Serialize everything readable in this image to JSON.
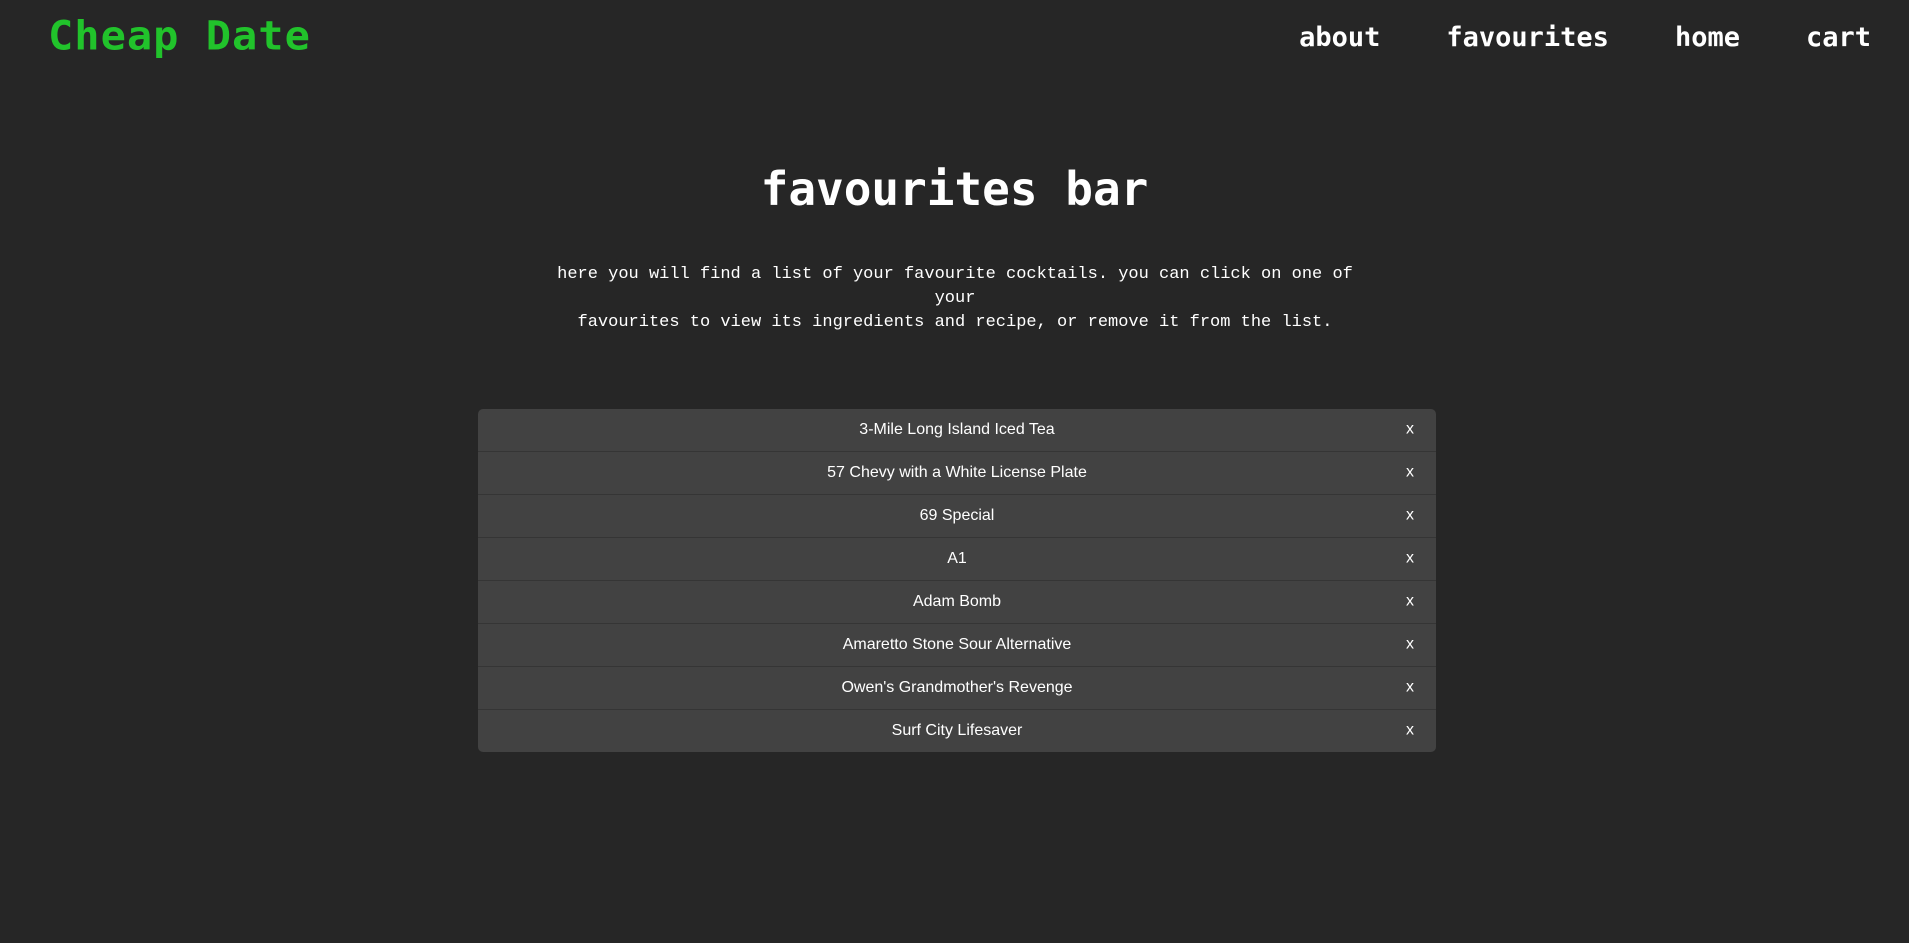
{
  "header": {
    "logo": "Cheap Date",
    "nav": {
      "about": "about",
      "favourites": "favourites",
      "home": "home",
      "cart": "cart"
    }
  },
  "main": {
    "title": "favourites bar",
    "intro_line1": "here you will find a list of your favourite cocktails. you can click on one of your",
    "intro_line2": "favourites to view its ingredients and recipe, or remove it from the list."
  },
  "favourites": [
    {
      "name": "3-Mile Long Island Iced Tea",
      "remove_label": "x"
    },
    {
      "name": "57 Chevy with a White License Plate",
      "remove_label": "x"
    },
    {
      "name": "69 Special",
      "remove_label": "x"
    },
    {
      "name": "A1",
      "remove_label": "x"
    },
    {
      "name": "Adam Bomb",
      "remove_label": "x"
    },
    {
      "name": "Amaretto Stone Sour Alternative",
      "remove_label": "x"
    },
    {
      "name": "Owen's Grandmother's Revenge",
      "remove_label": "x"
    },
    {
      "name": "Surf City Lifesaver",
      "remove_label": "x"
    }
  ],
  "colors": {
    "background": "#262626",
    "list_background": "#424242",
    "logo_accent": "#21c32b",
    "text": "#ffffff"
  }
}
